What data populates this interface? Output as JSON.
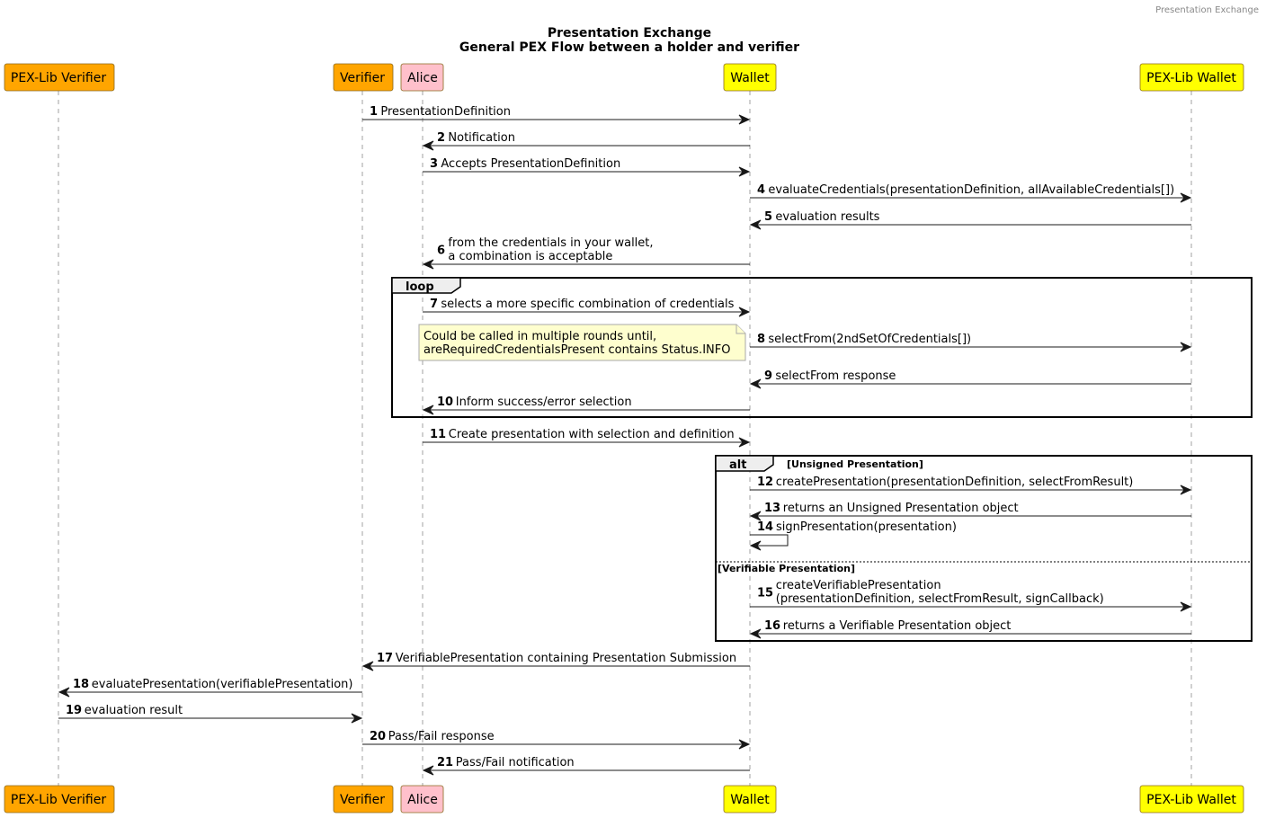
{
  "header": {
    "label": "Presentation Exchange"
  },
  "title": {
    "line1": "Presentation Exchange",
    "line2": "General PEX Flow between a holder and verifier"
  },
  "colors": {
    "orange": "#ffa500",
    "pink": "#ffc0cb",
    "yellow": "#ffff00",
    "note": "#fefece"
  },
  "participants": [
    {
      "id": "pexv",
      "label": "PEX-Lib Verifier",
      "color": "#ffa500"
    },
    {
      "id": "ver",
      "label": "Verifier",
      "color": "#ffa500"
    },
    {
      "id": "alice",
      "label": "Alice",
      "color": "#ffc0cb"
    },
    {
      "id": "wallet",
      "label": "Wallet",
      "color": "#ffff00"
    },
    {
      "id": "pexw",
      "label": "PEX-Lib Wallet",
      "color": "#ffff00"
    }
  ],
  "messages": [
    {
      "num": "1",
      "from": "ver",
      "to": "wallet",
      "text": [
        "PresentationDefinition"
      ]
    },
    {
      "num": "2",
      "from": "wallet",
      "to": "alice",
      "text": [
        "Notification"
      ]
    },
    {
      "num": "3",
      "from": "alice",
      "to": "wallet",
      "text": [
        "Accepts PresentationDefinition"
      ]
    },
    {
      "num": "4",
      "from": "wallet",
      "to": "pexw",
      "text": [
        "evaluateCredentials(presentationDefinition, allAvailableCredentials[])"
      ]
    },
    {
      "num": "5",
      "from": "pexw",
      "to": "wallet",
      "text": [
        "evaluation results"
      ]
    },
    {
      "num": "6",
      "from": "wallet",
      "to": "alice",
      "text": [
        "from the credentials in your wallet,",
        "a combination is acceptable"
      ]
    },
    {
      "num": "7",
      "from": "alice",
      "to": "wallet",
      "text": [
        "selects a more specific combination of credentials"
      ]
    },
    {
      "num": "8",
      "from": "wallet",
      "to": "pexw",
      "text": [
        "selectFrom(2ndSetOfCredentials[])"
      ]
    },
    {
      "num": "9",
      "from": "pexw",
      "to": "wallet",
      "text": [
        "selectFrom response"
      ]
    },
    {
      "num": "10",
      "from": "wallet",
      "to": "alice",
      "text": [
        "Inform success/error selection"
      ]
    },
    {
      "num": "11",
      "from": "alice",
      "to": "wallet",
      "text": [
        "Create presentation with selection and definition"
      ]
    },
    {
      "num": "12",
      "from": "wallet",
      "to": "pexw",
      "text": [
        "createPresentation(presentationDefinition, selectFromResult)"
      ]
    },
    {
      "num": "13",
      "from": "pexw",
      "to": "wallet",
      "text": [
        "returns an Unsigned Presentation object"
      ]
    },
    {
      "num": "14",
      "from": "wallet",
      "to": "wallet",
      "text": [
        "signPresentation(presentation)"
      ]
    },
    {
      "num": "15",
      "from": "wallet",
      "to": "pexw",
      "text": [
        "createVerifiablePresentation",
        "(presentationDefinition, selectFromResult, signCallback)"
      ]
    },
    {
      "num": "16",
      "from": "pexw",
      "to": "wallet",
      "text": [
        "returns a Verifiable Presentation object"
      ]
    },
    {
      "num": "17",
      "from": "wallet",
      "to": "ver",
      "text": [
        "VerifiablePresentation containing Presentation Submission"
      ]
    },
    {
      "num": "18",
      "from": "ver",
      "to": "pexv",
      "text": [
        "evaluatePresentation(verifiablePresentation)"
      ]
    },
    {
      "num": "19",
      "from": "pexv",
      "to": "ver",
      "text": [
        "evaluation result"
      ]
    },
    {
      "num": "20",
      "from": "ver",
      "to": "wallet",
      "text": [
        "Pass/Fail response"
      ]
    },
    {
      "num": "21",
      "from": "wallet",
      "to": "alice",
      "text": [
        "Pass/Fail notification"
      ]
    }
  ],
  "frames": [
    {
      "kind": "loop",
      "keyword": "loop",
      "guard": "",
      "covers": [
        "7",
        "10"
      ]
    },
    {
      "kind": "alt",
      "keyword": "alt",
      "guard": "[Unsigned Presentation]",
      "else_guard": "[Verifiable Presentation]",
      "covers": [
        "12",
        "16"
      ],
      "else_before": "15"
    }
  ],
  "notes": [
    {
      "anchor": "8",
      "side": "left-of-wallet",
      "lines": [
        "Could be called in multiple rounds until,",
        "areRequiredCredentialsPresent contains Status.INFO"
      ]
    }
  ]
}
